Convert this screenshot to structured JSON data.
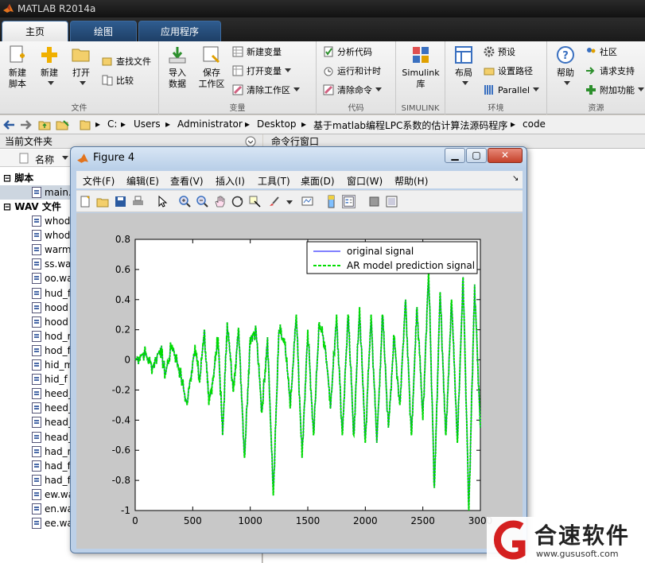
{
  "app": {
    "title": "MATLAB R2014a"
  },
  "tabs": [
    {
      "label": "主页"
    },
    {
      "label": "绘图"
    },
    {
      "label": "应用程序"
    }
  ],
  "ribbon": {
    "groups": [
      {
        "label": "文件"
      },
      {
        "label": "变量"
      },
      {
        "label": "代码"
      },
      {
        "label": "SIMULINK"
      },
      {
        "label": "环境"
      },
      {
        "label": "资源"
      }
    ],
    "new_script": {
      "line1": "新建",
      "line2": "脚本"
    },
    "new": "新建",
    "open": "打开",
    "find_files": "查找文件",
    "compare": "比较",
    "import": {
      "line1": "导入",
      "line2": "数据"
    },
    "save_ws": {
      "line1": "保存",
      "line2": "工作区"
    },
    "new_var": "新建变量",
    "open_var": "打开变量",
    "clear_ws": "清除工作区",
    "analyze_code": "分析代码",
    "run_time": "运行和计时",
    "clear_cmd": "清除命令",
    "simulink": {
      "line1": "Simulink",
      "line2": "库"
    },
    "layout": "布局",
    "prefs": "预设",
    "set_path": "设置路径",
    "parallel": "Parallel",
    "help": "帮助",
    "community": "社区",
    "request_support": "请求支持",
    "addons": "附加功能"
  },
  "address": {
    "segments": [
      "C:",
      "Users",
      "Administrator",
      "Desktop",
      "基于matlab编程LPC系数的估计算法源码程序",
      "code"
    ]
  },
  "left_panel": {
    "title": "当前文件夹",
    "col_name": "名称",
    "script_section": "脚本",
    "scripts": [
      "main.m"
    ],
    "wav_section": "WAV 文件",
    "wav_files": [
      "whod",
      "whod",
      "warm",
      "ss.wa",
      "oo.wa",
      "hud_f",
      "hood",
      "hood",
      "hod_r",
      "hod_f",
      "hid_m",
      "hid_f",
      "heed_",
      "heed_",
      "head_",
      "head_",
      "had_r",
      "had_f",
      "had_f",
      "ew.wa",
      "en.wa",
      "ee.wa"
    ]
  },
  "command_panel": {
    "title": "命令行窗口"
  },
  "figure": {
    "title": "Figure 4",
    "menus": [
      "文件(F)",
      "编辑(E)",
      "查看(V)",
      "插入(I)",
      "工具(T)",
      "桌面(D)",
      "窗口(W)",
      "帮助(H)"
    ]
  },
  "chart_data": {
    "type": "line",
    "title": "",
    "xlabel": "",
    "ylabel": "",
    "xlim": [
      0,
      3000
    ],
    "ylim": [
      -1,
      0.8
    ],
    "x_ticks": [
      "0",
      "500",
      "1000",
      "1500",
      "2000",
      "2500",
      "3000"
    ],
    "y_ticks": [
      "-1",
      "-0.8",
      "-0.6",
      "-0.4",
      "-0.2",
      "0",
      "0.2",
      "0.4",
      "0.6",
      "0.8"
    ],
    "legend_position": "top-right",
    "series": [
      {
        "name": "original signal",
        "color": "#0000ff",
        "style": "solid",
        "x": [
          0,
          80,
          150,
          220,
          260,
          320,
          380,
          450,
          520,
          560,
          600,
          640,
          680,
          720,
          760,
          800,
          850,
          900,
          950,
          1000,
          1050,
          1100,
          1150,
          1200,
          1250,
          1300,
          1350,
          1400,
          1450,
          1500,
          1550,
          1600,
          1650,
          1700,
          1750,
          1800,
          1850,
          1900,
          1950,
          2000,
          2050,
          2100,
          2150,
          2200,
          2250,
          2300,
          2350,
          2400,
          2450,
          2500,
          2550,
          2600,
          2650,
          2700,
          2750,
          2800,
          2850,
          2900,
          2950,
          3000
        ],
        "y": [
          0,
          0.05,
          -0.05,
          0.08,
          -0.1,
          0.1,
          -0.05,
          -0.3,
          0.1,
          -0.15,
          0.2,
          -0.3,
          -0.1,
          0.15,
          -0.5,
          0.25,
          -0.2,
          0.2,
          -0.65,
          0.15,
          0.2,
          -0.35,
          0.15,
          -0.9,
          0.2,
          0.1,
          -0.3,
          0.3,
          -0.65,
          0.2,
          -0.5,
          0.25,
          0.1,
          -0.3,
          0.3,
          -0.5,
          0.3,
          -0.5,
          0.35,
          -0.55,
          0.3,
          -0.55,
          0.3,
          -0.45,
          0.15,
          -0.3,
          0.4,
          -0.5,
          0.35,
          -0.4,
          0.6,
          -0.85,
          0.45,
          -0.5,
          0.4,
          -0.55,
          0.55,
          -1.0,
          0.5,
          -0.45
        ]
      },
      {
        "name": "AR model prediction signal",
        "color": "#00dd00",
        "style": "dashed",
        "x": [
          0,
          80,
          150,
          220,
          260,
          320,
          380,
          450,
          520,
          560,
          600,
          640,
          680,
          720,
          760,
          800,
          850,
          900,
          950,
          1000,
          1050,
          1100,
          1150,
          1200,
          1250,
          1300,
          1350,
          1400,
          1450,
          1500,
          1550,
          1600,
          1650,
          1700,
          1750,
          1800,
          1850,
          1900,
          1950,
          2000,
          2050,
          2100,
          2150,
          2200,
          2250,
          2300,
          2350,
          2400,
          2450,
          2500,
          2550,
          2600,
          2650,
          2700,
          2750,
          2800,
          2850,
          2900,
          2950,
          3000
        ],
        "y": [
          0,
          0.05,
          -0.05,
          0.08,
          -0.1,
          0.1,
          -0.05,
          -0.3,
          0.1,
          -0.15,
          0.2,
          -0.3,
          -0.1,
          0.15,
          -0.5,
          0.25,
          -0.2,
          0.2,
          -0.65,
          0.15,
          0.2,
          -0.35,
          0.15,
          -0.9,
          0.2,
          0.1,
          -0.3,
          0.3,
          -0.65,
          0.2,
          -0.5,
          0.25,
          0.1,
          -0.3,
          0.3,
          -0.5,
          0.3,
          -0.5,
          0.35,
          -0.55,
          0.3,
          -0.55,
          0.3,
          -0.45,
          0.15,
          -0.3,
          0.4,
          -0.5,
          0.35,
          -0.4,
          0.6,
          -0.85,
          0.45,
          -0.5,
          0.4,
          -0.55,
          0.55,
          -1.0,
          0.5,
          -0.45
        ]
      }
    ]
  },
  "watermark": {
    "name": "合速软件",
    "url": "www.gususoft.com"
  },
  "colors": {
    "accent": "#2f5c8f",
    "signal": "#00dd00",
    "watermark_red": "#d42020"
  }
}
